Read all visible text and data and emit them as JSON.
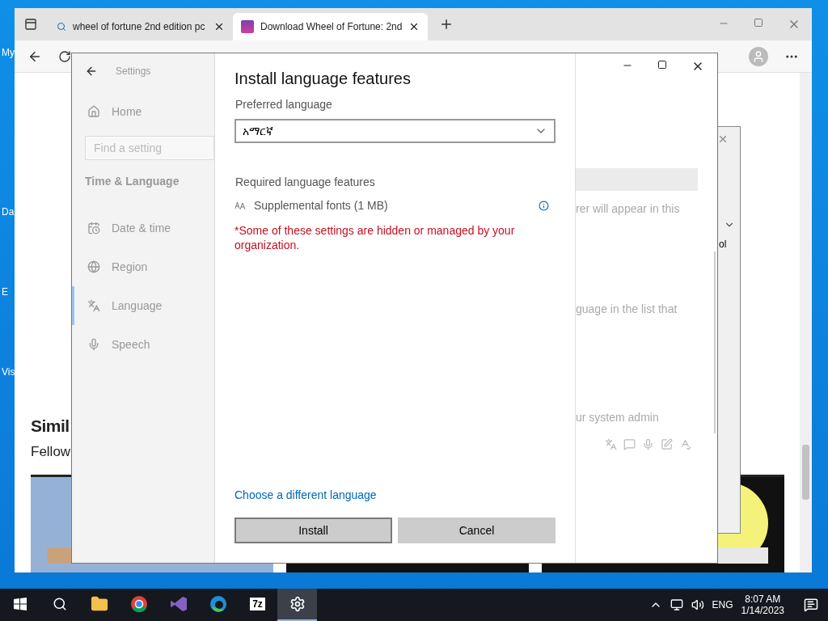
{
  "desktop": {
    "icons": [
      "My",
      "Da",
      "E",
      "Vis"
    ]
  },
  "browser": {
    "tabs": [
      {
        "title": "wheel of fortune 2nd edition pc",
        "kind": "search",
        "selected": false
      },
      {
        "title": "Download Wheel of Fortune: 2nd",
        "kind": "site",
        "selected": true
      }
    ],
    "page": {
      "heading": "Simil",
      "subheading": "Fellow"
    }
  },
  "side_window": {
    "fragment": "ol"
  },
  "settings": {
    "title": "Settings",
    "home": "Home",
    "search_placeholder": "Find a setting",
    "section": "Time & Language",
    "nav": [
      {
        "label": "Date & time",
        "kind": "calendar",
        "selected": false
      },
      {
        "label": "Region",
        "kind": "globe",
        "selected": false
      },
      {
        "label": "Language",
        "kind": "language",
        "selected": true
      },
      {
        "label": "Speech",
        "kind": "mic",
        "selected": false
      }
    ],
    "background_texts": [
      "rer will appear in this",
      "guage in the list that",
      "ur system admin"
    ]
  },
  "dialog": {
    "title": "Install language features",
    "preferred_label": "Preferred language",
    "language": "አማርኛ",
    "required_label": "Required language features",
    "features": [
      {
        "label": "Supplemental fonts (1 MB)"
      }
    ],
    "warning": "*Some of these settings are hidden or managed by your organization.",
    "link": "Choose a different language",
    "buttons": [
      {
        "label": "Install",
        "kind": "focused"
      },
      {
        "label": "Cancel",
        "kind": "normal"
      }
    ]
  },
  "taskbar": {
    "apps": [
      {
        "kind": "folder",
        "selected": false
      },
      {
        "kind": "chrome",
        "selected": false
      },
      {
        "kind": "vs",
        "selected": false
      },
      {
        "kind": "edge",
        "selected": false
      },
      {
        "kind": "archiver",
        "label": "7z",
        "selected": false
      },
      {
        "kind": "settings",
        "selected": true
      }
    ],
    "language": "ENG",
    "time": "8:07 AM",
    "date": "1/14/2023"
  }
}
